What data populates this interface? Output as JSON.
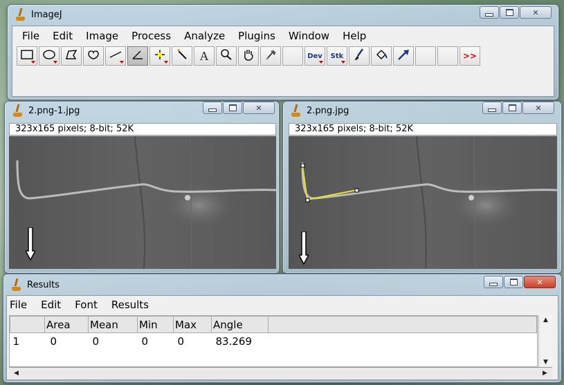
{
  "main_window": {
    "title": "ImageJ",
    "menu": [
      "File",
      "Edit",
      "Image",
      "Process",
      "Analyze",
      "Plugins",
      "Window",
      "Help"
    ],
    "tools": [
      {
        "name": "rectangle-tool-icon",
        "glyph": "",
        "selected": false,
        "has_menu": true
      },
      {
        "name": "oval-tool-icon",
        "glyph": "",
        "selected": false,
        "has_menu": true
      },
      {
        "name": "polygon-tool-icon",
        "glyph": "",
        "selected": false,
        "has_menu": false
      },
      {
        "name": "freehand-tool-icon",
        "glyph": "",
        "selected": false,
        "has_menu": false
      },
      {
        "name": "line-tool-icon",
        "glyph": "",
        "selected": false,
        "has_menu": true
      },
      {
        "name": "angle-tool-icon",
        "glyph": "",
        "selected": true,
        "has_menu": false
      },
      {
        "name": "point-tool-icon",
        "glyph": "",
        "selected": false,
        "has_menu": true
      },
      {
        "name": "wand-tool-icon",
        "glyph": "",
        "selected": false,
        "has_menu": false
      },
      {
        "name": "text-tool-icon",
        "glyph": "A",
        "selected": false,
        "has_menu": false
      },
      {
        "name": "magnifier-tool-icon",
        "glyph": "",
        "selected": false,
        "has_menu": false
      },
      {
        "name": "hand-tool-icon",
        "glyph": "",
        "selected": false,
        "has_menu": false
      },
      {
        "name": "color-picker-tool-icon",
        "glyph": "",
        "selected": false,
        "has_menu": false
      },
      {
        "name": "blank-tool",
        "glyph": "",
        "selected": false,
        "has_menu": false
      },
      {
        "name": "dev-tool",
        "glyph": "Dev",
        "selected": false,
        "has_menu": true
      },
      {
        "name": "stk-tool",
        "glyph": "Stk",
        "selected": false,
        "has_menu": true
      },
      {
        "name": "brush-tool-icon",
        "glyph": "",
        "selected": false,
        "has_menu": false
      },
      {
        "name": "flood-fill-tool-icon",
        "glyph": "",
        "selected": false,
        "has_menu": false
      },
      {
        "name": "arrow-tool-icon",
        "glyph": "",
        "selected": false,
        "has_menu": false
      },
      {
        "name": "blank-tool",
        "glyph": "",
        "selected": false,
        "has_menu": false
      },
      {
        "name": "blank-tool",
        "glyph": "",
        "selected": false,
        "has_menu": false
      },
      {
        "name": "more-tools-icon",
        "glyph": ">>",
        "selected": false,
        "has_menu": false
      }
    ]
  },
  "image_left": {
    "title": "2.png-1.jpg",
    "info": "323x165 pixels; 8-bit; 52K"
  },
  "image_right": {
    "title": "2.png.jpg",
    "info": "323x165 pixels; 8-bit; 52K"
  },
  "results_window": {
    "title": "Results",
    "menu": [
      "File",
      "Edit",
      "Font",
      "Results"
    ],
    "columns": [
      "",
      "Area",
      "Mean",
      "Min",
      "Max",
      "Angle"
    ],
    "rows": [
      [
        "1",
        "0",
        "0",
        "0",
        "0",
        "83.269"
      ]
    ]
  },
  "colors": {
    "selection_line": "#e8e030",
    "canvas_bg": "#5c5c5c"
  }
}
